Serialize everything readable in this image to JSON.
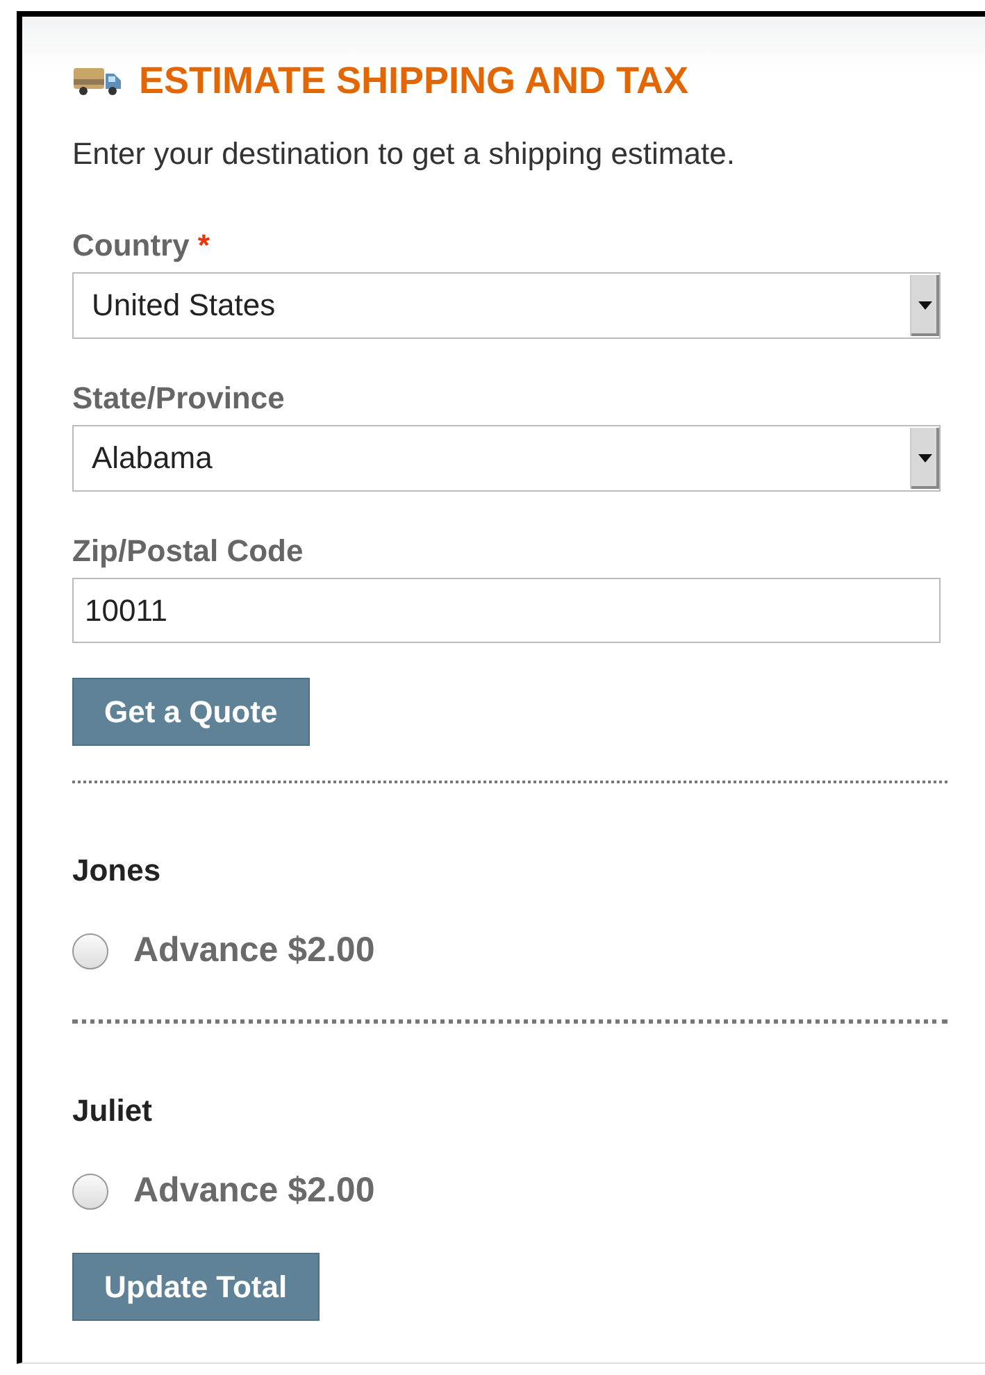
{
  "title": "ESTIMATE SHIPPING AND TAX",
  "intro": "Enter your destination to get a shipping estimate.",
  "required_mark": "*",
  "fields": [
    {
      "kind": "select",
      "label": "Country",
      "required": true,
      "value": "United States"
    },
    {
      "kind": "select",
      "label": "State/Province",
      "required": false,
      "value": "Alabama"
    },
    {
      "kind": "text",
      "label": "Zip/Postal Code",
      "required": false,
      "value": "10011"
    }
  ],
  "quote_button": "Get a Quote",
  "carriers": [
    {
      "name": "Jones",
      "options": [
        {
          "label": "Advance $2.00",
          "selected": false
        }
      ]
    },
    {
      "name": "Juliet",
      "options": [
        {
          "label": "Advance $2.00",
          "selected": false
        }
      ]
    }
  ],
  "update_button": "Update Total"
}
